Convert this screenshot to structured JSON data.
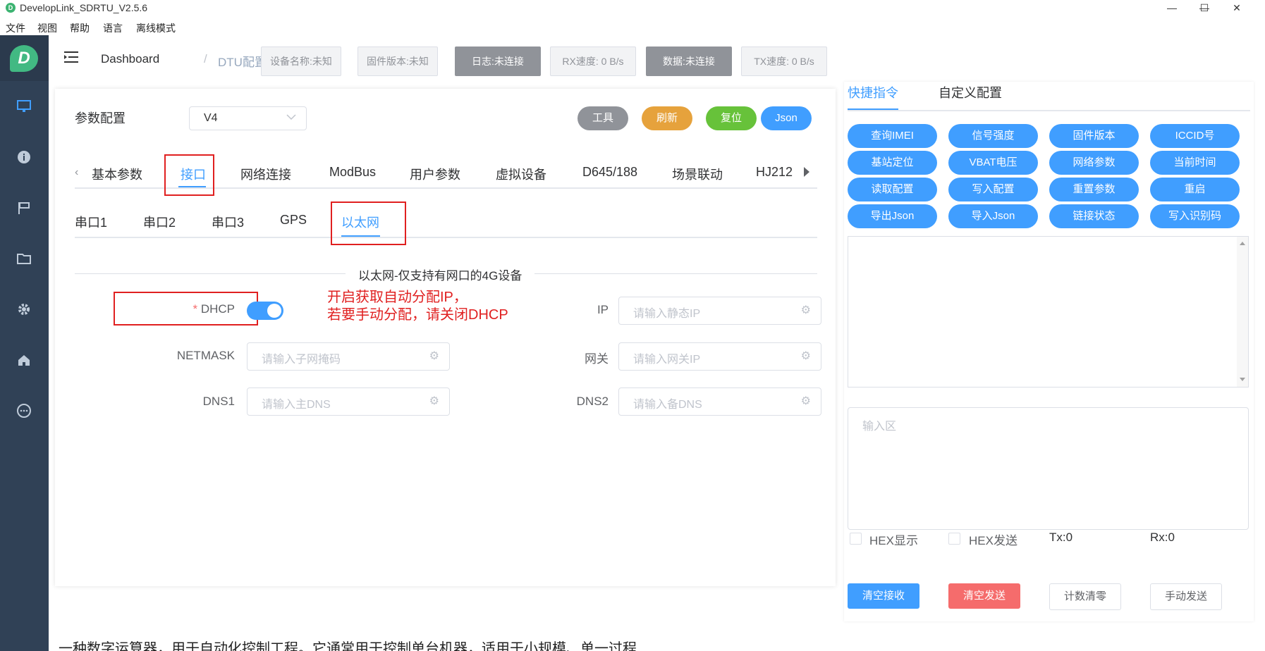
{
  "window": {
    "title": "DevelopLink_SDRTU_V2.5.6",
    "minimize": "—",
    "maximize": "☐",
    "close": "✕",
    "logo_letter": "D"
  },
  "menu": [
    "文件",
    "视图",
    "帮助",
    "语言",
    "离线模式"
  ],
  "brand": {
    "letter": "D"
  },
  "sidebar_icons": [
    "monitor-icon",
    "info-icon",
    "flag-icon",
    "folder-icon",
    "gear-icon",
    "home-icon",
    "chat-icon"
  ],
  "breadcrumb": {
    "root": "Dashboard",
    "sep": "/",
    "current": "DTU配置"
  },
  "status": {
    "device_name": "设备名称:未知",
    "firmware": "固件版本:未知",
    "log": "日志:未连接",
    "rx_speed": "RX速度: 0 B/s",
    "data": "数据:未连接",
    "tx_speed": "TX速度: 0 B/s"
  },
  "panel": {
    "title": "参数配置",
    "version": "V4",
    "buttons": {
      "tools": "工具",
      "refresh": "刷新",
      "reset": "复位",
      "json": "Json"
    },
    "colors": {
      "tools": "#909399",
      "refresh": "#e6a23c",
      "reset": "#67c23a",
      "json": "#409eff"
    }
  },
  "tabs_main": [
    "基本参数",
    "接口",
    "网络连接",
    "ModBus",
    "用户参数",
    "虚拟设备",
    "D645/188",
    "场景联动",
    "HJ212"
  ],
  "tabs_main_active": "接口",
  "tabs_sub": [
    "串口1",
    "串口2",
    "串口3",
    "GPS",
    "以太网"
  ],
  "tabs_sub_active": "以太网",
  "section_title": "以太网-仅支持有网口的4G设备",
  "form": {
    "dhcp": {
      "required_mark": "*",
      "label": "DHCP",
      "value": true
    },
    "ip": {
      "label": "IP",
      "placeholder": "请输入静态IP"
    },
    "netmask": {
      "label": "NETMASK",
      "placeholder": "请输入子网掩码"
    },
    "gateway": {
      "label": "网关",
      "placeholder": "请输入网关IP"
    },
    "dns1": {
      "label": "DNS1",
      "placeholder": "请输入主DNS"
    },
    "dns2": {
      "label": "DNS2",
      "placeholder": "请输入备DNS"
    }
  },
  "annotation": {
    "line1": "开启获取自动分配IP，",
    "line2": "若要手动分配，请关闭DHCP"
  },
  "right": {
    "tabs": [
      "快捷指令",
      "自定义配置"
    ],
    "tabs_active": "快捷指令",
    "commands": [
      "查询IMEI",
      "信号强度",
      "固件版本",
      "ICCID号",
      "基站定位",
      "VBAT电压",
      "网络参数",
      "当前时间",
      "读取配置",
      "写入配置",
      "重置参数",
      "重启",
      "导出Json",
      "导入Json",
      "链接状态",
      "写入识别码"
    ],
    "input_placeholder": "输入区",
    "hex_display": "HEX显示",
    "hex_send": "HEX发送",
    "tx": "Tx:0",
    "rx": "Rx:0",
    "buttons": {
      "clear_rx": "清空接收",
      "clear_tx": "清空发送",
      "reset_count": "计数清零",
      "manual_send": "手动发送"
    }
  },
  "bottom_text": "一种数字运算器，用于自动化控制工程。它通常用于控制单台机器，适用于小规模、单一过程"
}
